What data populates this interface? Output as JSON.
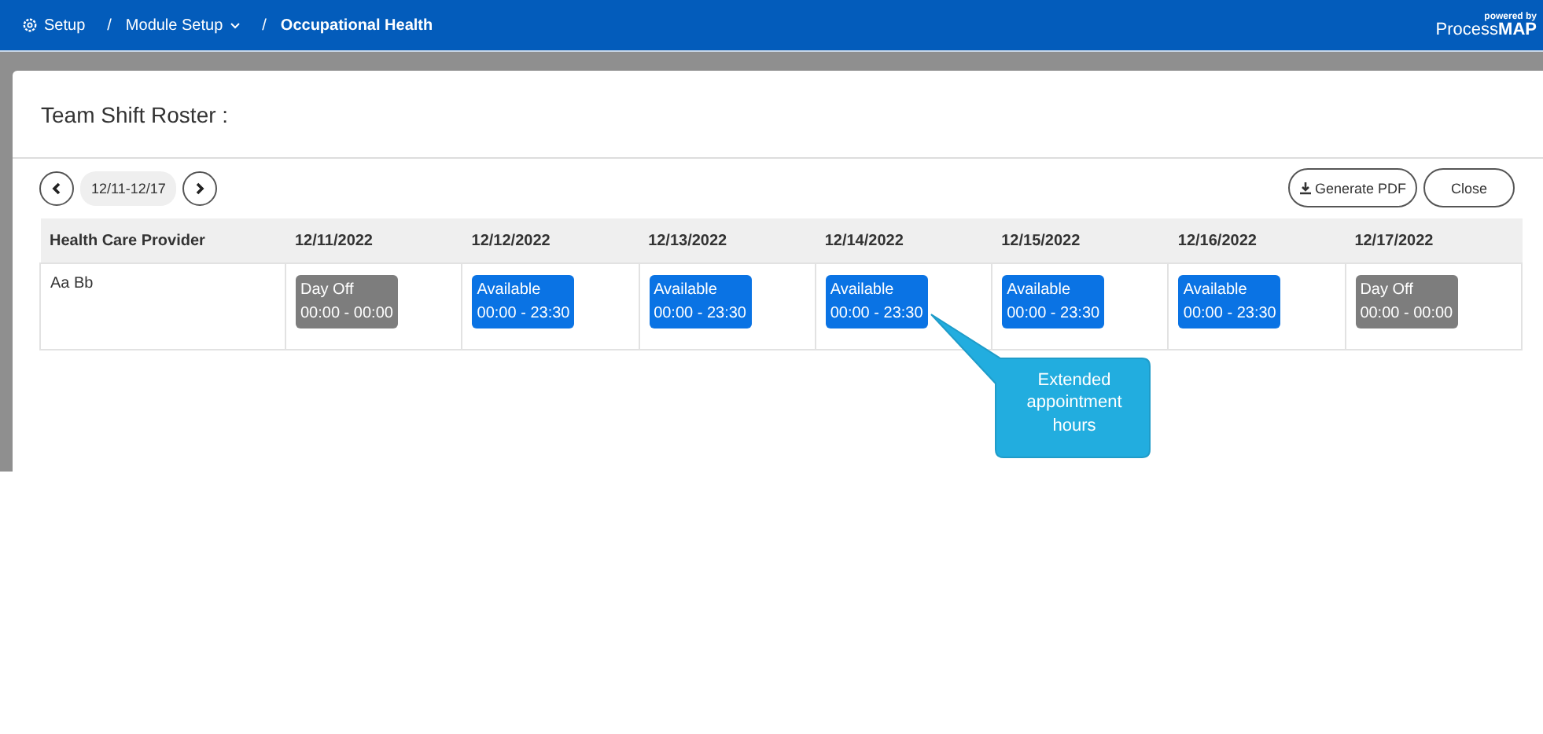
{
  "breadcrumb": [
    {
      "label": "Setup",
      "kind": "home"
    },
    {
      "label": "Module Setup",
      "kind": "dropdown"
    },
    {
      "label": "Occupational Health",
      "kind": "current"
    }
  ],
  "breadcrumb_separator": "/",
  "brand": {
    "tagline": "powered by",
    "name_light": "Process",
    "name_bold": "MAP"
  },
  "dialog": {
    "title": "Team Shift Roster :",
    "week": "12/11-12/17",
    "buttons": [
      {
        "label": "Generate PDF",
        "kind": "download"
      },
      {
        "label": "Close",
        "kind": "plain"
      }
    ]
  },
  "table": {
    "columns": [
      "Health Care Provider",
      "12/11/2022",
      "12/12/2022",
      "12/13/2022",
      "12/14/2022",
      "12/15/2022",
      "12/16/2022",
      "12/17/2022"
    ],
    "rows": [
      {
        "provider": "Aa Bb",
        "shifts": [
          {
            "kind": "day_off",
            "status": "Day Off",
            "hours": "00:00 - 00:00"
          },
          {
            "kind": "available",
            "status": "Available",
            "hours": "00:00 - 23:30"
          },
          {
            "kind": "available",
            "status": "Available",
            "hours": "00:00 - 23:30"
          },
          {
            "kind": "available",
            "status": "Available",
            "hours": "00:00 - 23:30"
          },
          {
            "kind": "available",
            "status": "Available",
            "hours": "00:00 - 23:30"
          },
          {
            "kind": "available",
            "status": "Available",
            "hours": "00:00 - 23:30"
          },
          {
            "kind": "day_off",
            "status": "Day Off",
            "hours": "00:00 - 00:00"
          }
        ]
      }
    ]
  },
  "callout": {
    "text": "Extended appointment hours"
  }
}
